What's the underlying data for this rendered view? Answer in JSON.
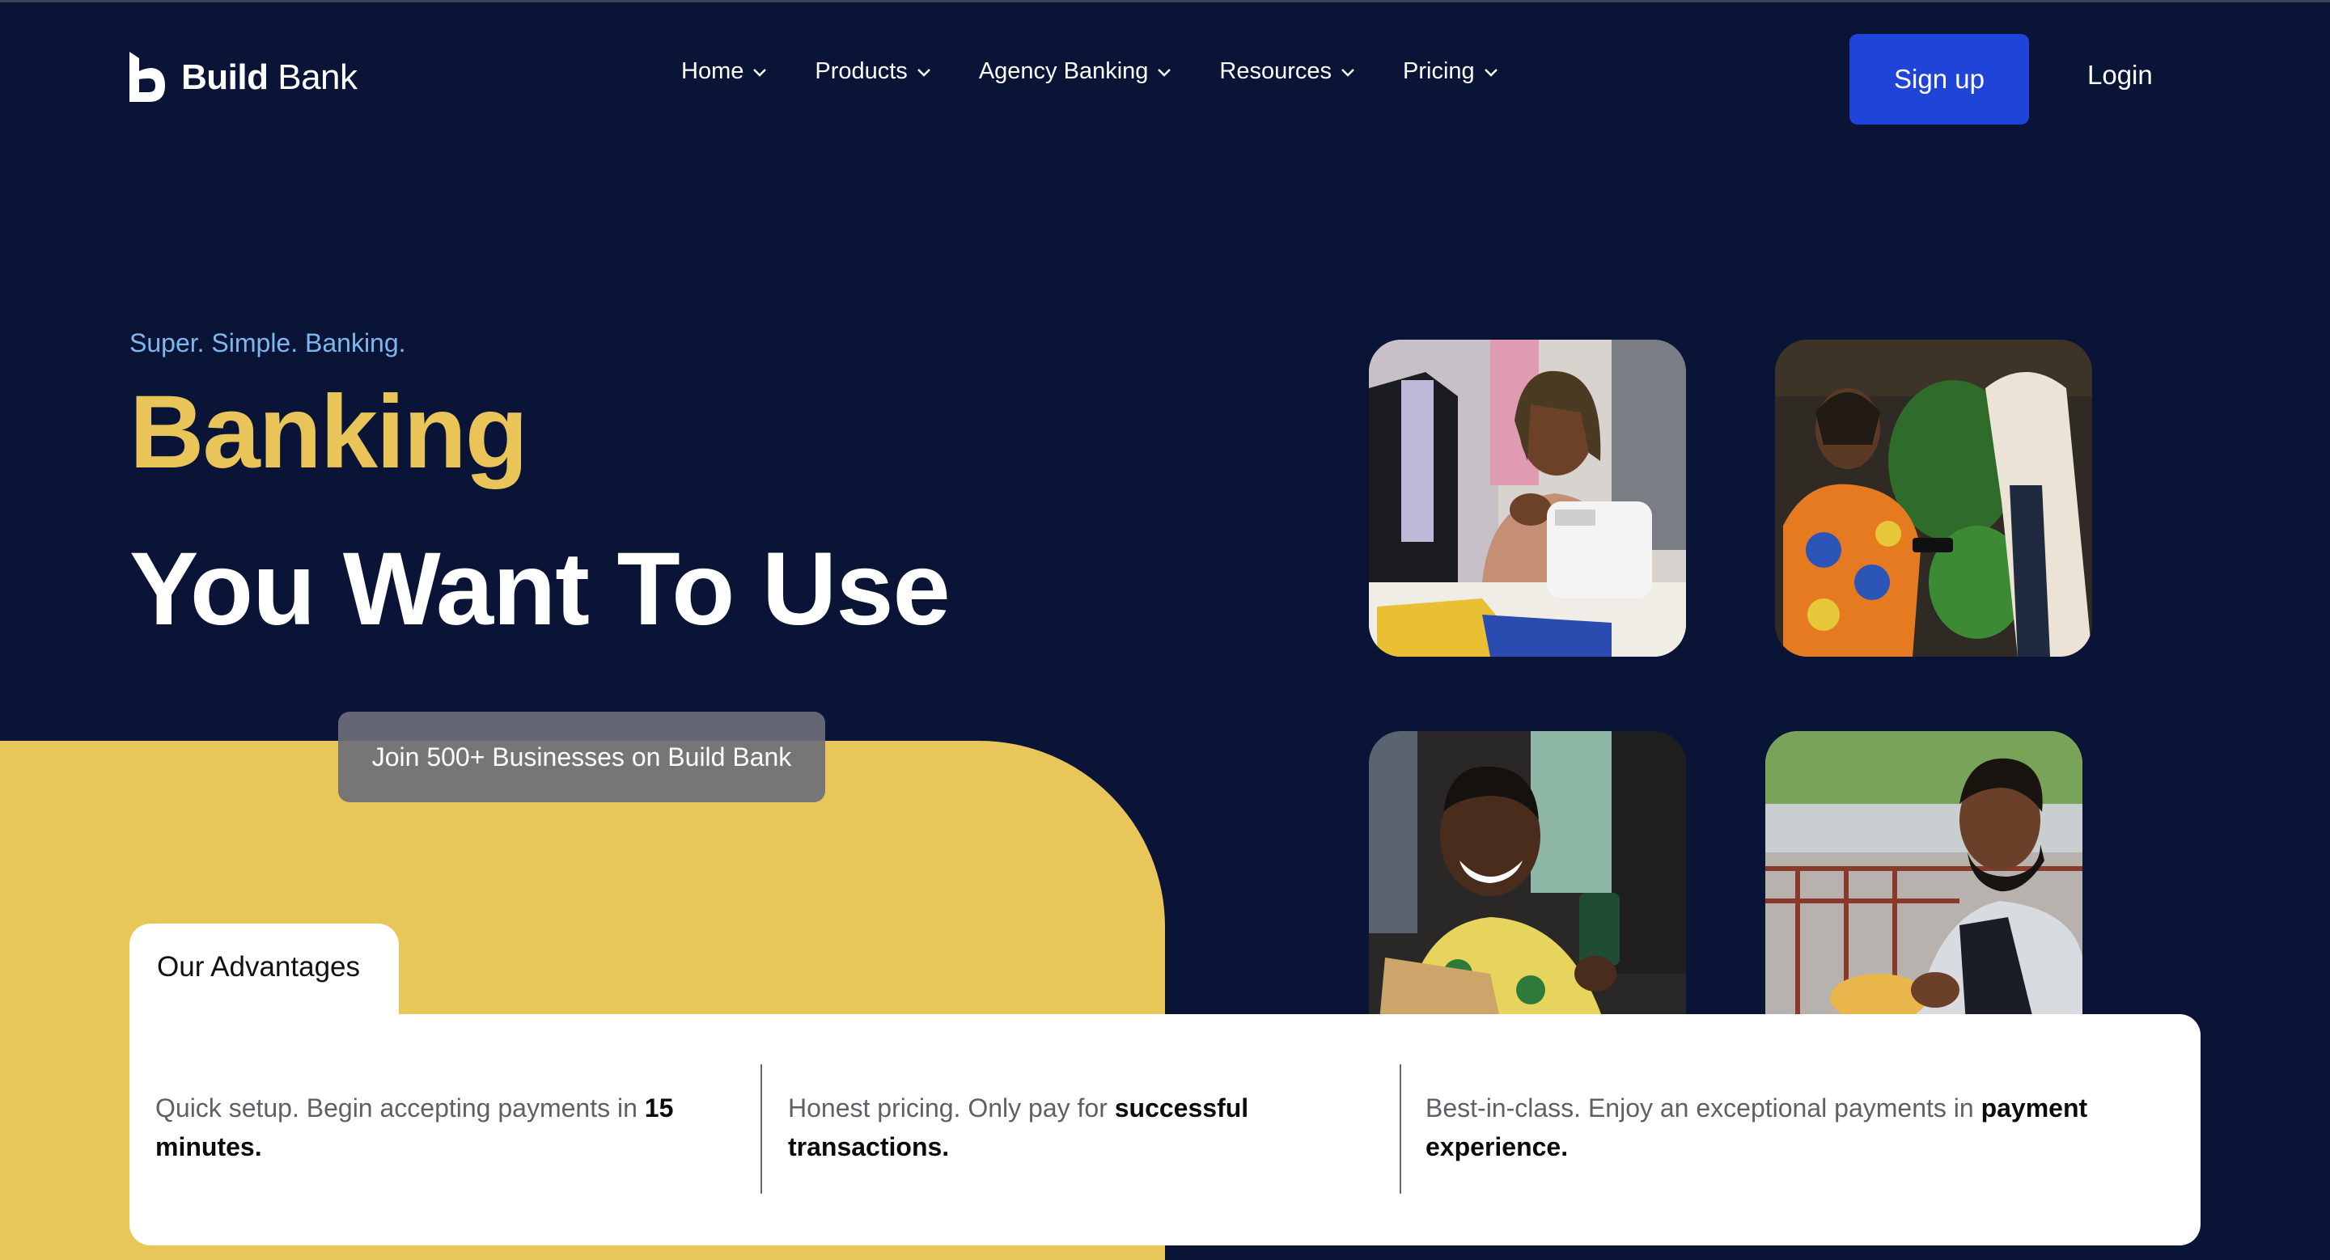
{
  "header": {
    "logo_text_bold": "Build",
    "logo_text_regular": "Bank",
    "nav": [
      {
        "label": "Home"
      },
      {
        "label": "Products"
      },
      {
        "label": "Agency Banking"
      },
      {
        "label": "Resources"
      },
      {
        "label": "Pricing"
      }
    ],
    "signup_label": "Sign up",
    "login_label": "Login"
  },
  "hero": {
    "tagline": "Super. Simple. Banking.",
    "headline_line1": "Banking",
    "headline_line2": "You Want To Use",
    "join_text": "Join 500+ Businesses on Build Bank"
  },
  "advantages": {
    "tab_label": "Our Advantages",
    "items": [
      {
        "text": "Quick setup. Begin accepting payments in ",
        "bold": "15 minutes."
      },
      {
        "text": "Honest pricing. Only pay for ",
        "bold": "successful transactions."
      },
      {
        "text": "Best-in-class. Enjoy an exceptional payments in ",
        "bold": "payment experience."
      }
    ]
  },
  "colors": {
    "background": "#0a1436",
    "accent_yellow": "#e8c65a",
    "button_blue": "#1f45d8",
    "tagline_blue": "#7db7ee"
  }
}
